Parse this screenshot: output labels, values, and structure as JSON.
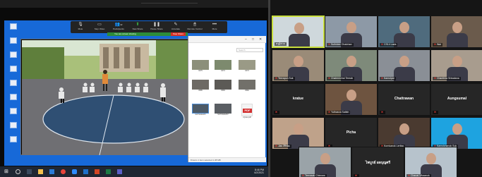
{
  "shared_screen": {
    "zoom_controls": [
      {
        "icon": "mic-icon",
        "label": "Mute"
      },
      {
        "icon": "video-icon",
        "label": "Stop Video"
      },
      {
        "icon": "participants-icon",
        "label": "Participants"
      },
      {
        "icon": "share-icon",
        "label": "New Share"
      },
      {
        "icon": "pause-icon",
        "label": "Pause Share"
      },
      {
        "icon": "annotate-icon",
        "label": "Annotate"
      },
      {
        "icon": "remote-control-icon",
        "label": "Remote Control"
      },
      {
        "icon": "more-icon",
        "label": "More"
      }
    ],
    "participant_count": "42",
    "share_banner": "You are screen sharing",
    "stop_share_label": "Stop Share",
    "explorer": {
      "search_placeholder": "Search",
      "thumbnails": [
        {
          "caption": "0275"
        },
        {
          "caption": "0274"
        },
        {
          "caption": "0273"
        },
        {
          "caption": "0585"
        },
        {
          "caption": "0583"
        },
        {
          "caption": "0582"
        },
        {
          "caption": "SOTSN01057"
        },
        {
          "caption": "SOTSN01057"
        },
        {
          "caption": "สรุปผล.pdf"
        }
      ],
      "pdf_label": "PDF",
      "status": "8 items   1 item selected  1.38 MB"
    },
    "taskbar": {
      "time": "8:46 PM",
      "date": "6/2/2021"
    }
  },
  "gallery": {
    "speaking_color": "#c9df3d",
    "tiles": [
      {
        "name": "ครูผู้ช่วย",
        "muted": false,
        "type": "video",
        "speaking": true,
        "bg": "#cfd8dc"
      },
      {
        "name": "Suthidee Chaichan",
        "muted": true,
        "type": "video",
        "speaking": false,
        "bg": "#8d99a6"
      },
      {
        "name": "CS14 Lada",
        "muted": true,
        "type": "video",
        "speaking": false,
        "bg": "#4f6b7d"
      },
      {
        "name": "Wai",
        "muted": true,
        "type": "video",
        "speaking": false,
        "bg": "#6b5b4c"
      },
      {
        "name": "Teerapun Suk",
        "muted": true,
        "type": "video",
        "speaking": false,
        "bg": "#9a8b78"
      },
      {
        "name": "Chalermchai Teerab",
        "muted": true,
        "type": "video",
        "speaking": false,
        "bg": "#7e8a7a"
      },
      {
        "name": "Kamolpar",
        "muted": true,
        "type": "video",
        "speaking": false,
        "bg": "#8a8f96"
      },
      {
        "name": "Chanthira Sriwatana",
        "muted": true,
        "type": "video",
        "speaking": false,
        "bg": "#a89c8e"
      },
      {
        "name": "kratue",
        "muted": true,
        "type": "name",
        "speaking": false,
        "bg": "#262626"
      },
      {
        "name": "Yuthasna Saifah",
        "muted": true,
        "type": "video",
        "speaking": false,
        "bg": "#6e5440"
      },
      {
        "name": "Chattrawan",
        "muted": true,
        "type": "name",
        "speaking": false,
        "bg": "#262626"
      },
      {
        "name": "Aungsumal",
        "muted": true,
        "type": "name",
        "speaking": false,
        "bg": "#262626"
      },
      {
        "name": "Jian สิริพัฒ",
        "muted": true,
        "type": "video",
        "speaking": false,
        "bg": "#bfa28a"
      },
      {
        "name": "Picha",
        "muted": true,
        "type": "name",
        "speaking": false,
        "bg": "#262626"
      },
      {
        "name": "Kornkanok Lertlao",
        "muted": true,
        "type": "video",
        "speaking": false,
        "bg": "#4a3a30"
      },
      {
        "name": "Kamolchanok Suk",
        "muted": true,
        "type": "video",
        "speaking": false,
        "bg": "#1ea3e0"
      },
      {
        "name": "Teerasak Chinnaw",
        "muted": true,
        "type": "video",
        "speaking": false,
        "bg": "#9aa3a8"
      },
      {
        "name": "ไพบูรย์ ผลบุญศรี",
        "muted": true,
        "type": "name",
        "speaking": false,
        "bg": "#262626"
      },
      {
        "name": "Chanat Vibaanok",
        "muted": true,
        "type": "video",
        "speaking": false,
        "bg": "#b7c3cc"
      }
    ]
  }
}
